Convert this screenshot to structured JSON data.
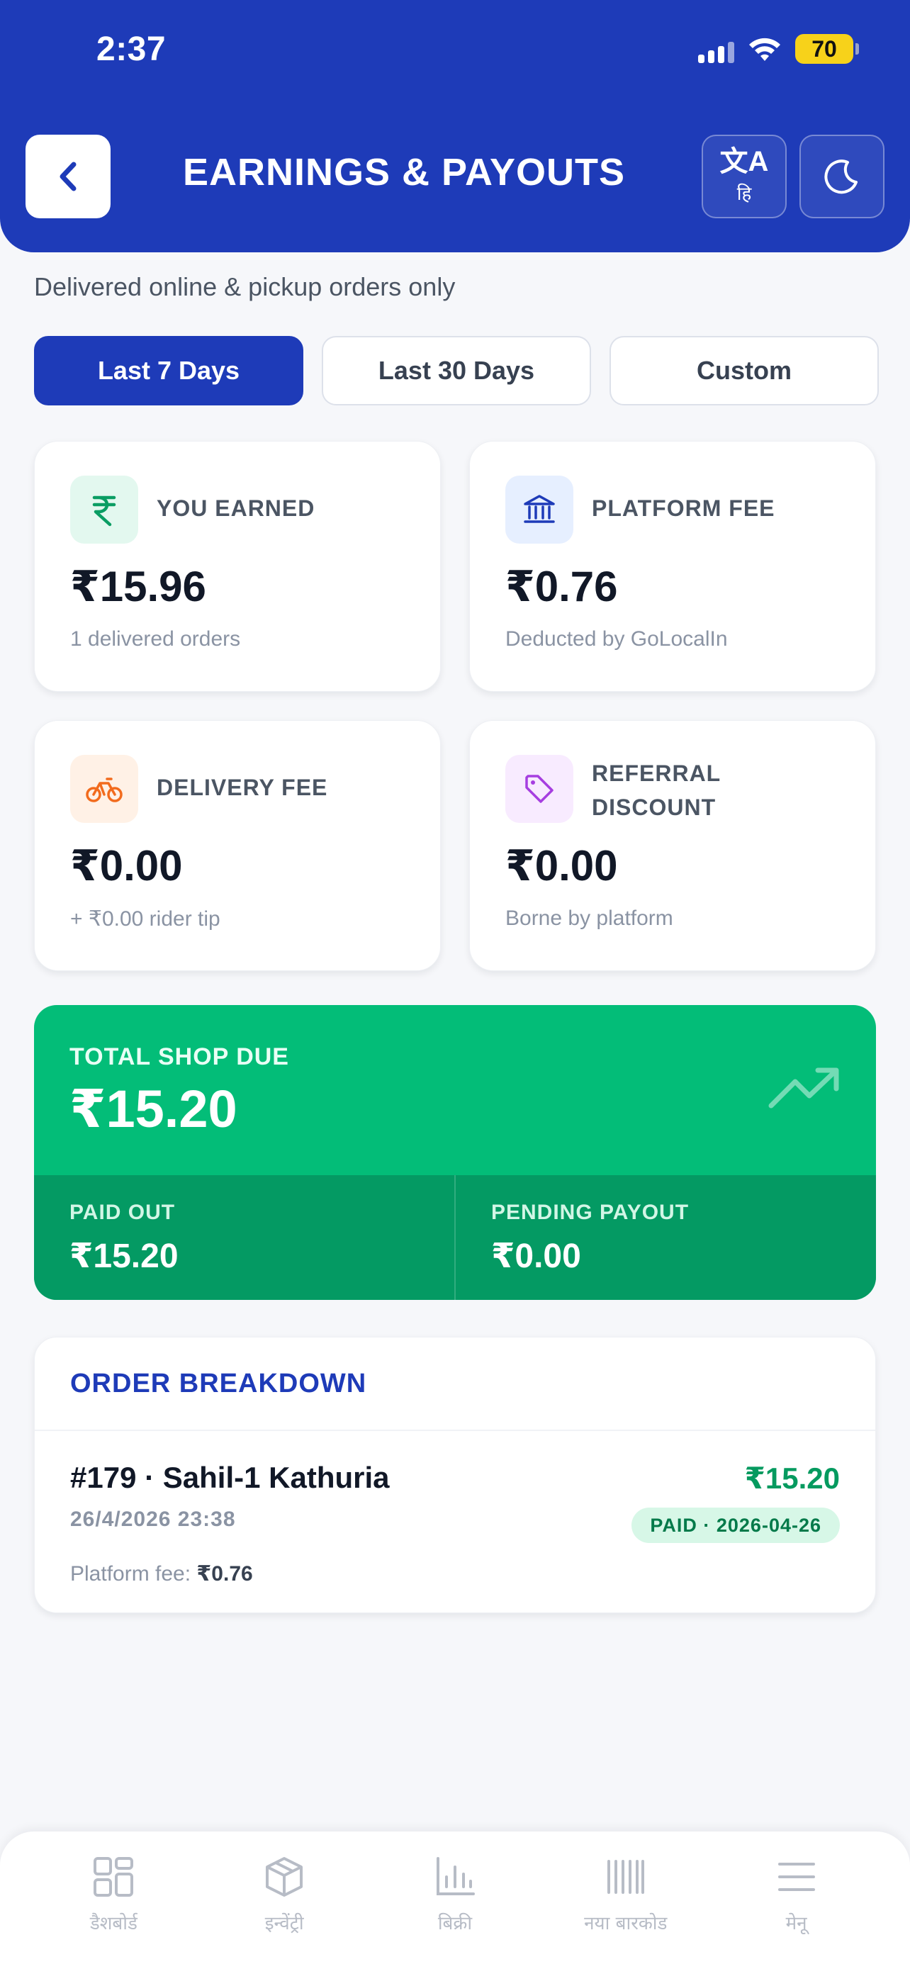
{
  "status_bar": {
    "time": "2:37",
    "battery": "70"
  },
  "header": {
    "title": "EARNINGS & PAYOUTS",
    "translate_glyph": "文A",
    "translate_sub": "हि"
  },
  "subtitle": "Delivered online & pickup orders only",
  "tabs": [
    {
      "label": "Last 7 Days",
      "active": true
    },
    {
      "label": "Last 30 Days",
      "active": false
    },
    {
      "label": "Custom",
      "active": false
    }
  ],
  "stats": {
    "you_earned": {
      "label": "YOU EARNED",
      "amount": "₹15.96",
      "note": "1 delivered orders",
      "icon": "rupee-icon"
    },
    "platform_fee": {
      "label": "PLATFORM FEE",
      "amount": "₹0.76",
      "note": "Deducted by GoLocalIn",
      "icon": "bank-icon"
    },
    "delivery_fee": {
      "label": "DELIVERY FEE",
      "amount": "₹0.00",
      "note": "+ ₹0.00 rider tip",
      "icon": "bicycle-icon"
    },
    "referral_discount": {
      "label": "REFERRAL DISCOUNT",
      "amount": "₹0.00",
      "note": "Borne by platform",
      "icon": "tag-icon"
    }
  },
  "total_due": {
    "label": "TOTAL SHOP DUE",
    "amount": "₹15.20",
    "paid_out_label": "PAID OUT",
    "paid_out_amount": "₹15.20",
    "pending_label": "PENDING PAYOUT",
    "pending_amount": "₹0.00"
  },
  "order_breakdown": {
    "title": "ORDER BREAKDOWN",
    "orders": [
      {
        "name": "#179 · Sahil-1 Kathuria",
        "date": "26/4/2026 23:38",
        "amount": "₹15.20",
        "status": "PAID · 2026-04-26",
        "fee_label": "Platform fee:",
        "fee_value": "₹0.76"
      }
    ]
  },
  "bottom_nav": [
    {
      "label": "डैशबोर्ड",
      "icon": "dashboard-icon"
    },
    {
      "label": "इन्वेंट्री",
      "icon": "box-icon"
    },
    {
      "label": "बिक्री",
      "icon": "bar-chart-icon"
    },
    {
      "label": "नया बारकोड",
      "icon": "barcode-icon"
    },
    {
      "label": "मेनू",
      "icon": "menu-icon"
    }
  ],
  "colors": {
    "primary": "#1e3bb8",
    "success": "#03bd78",
    "success_dark": "#049a63",
    "text": "#111827",
    "muted": "#8a93a3"
  }
}
